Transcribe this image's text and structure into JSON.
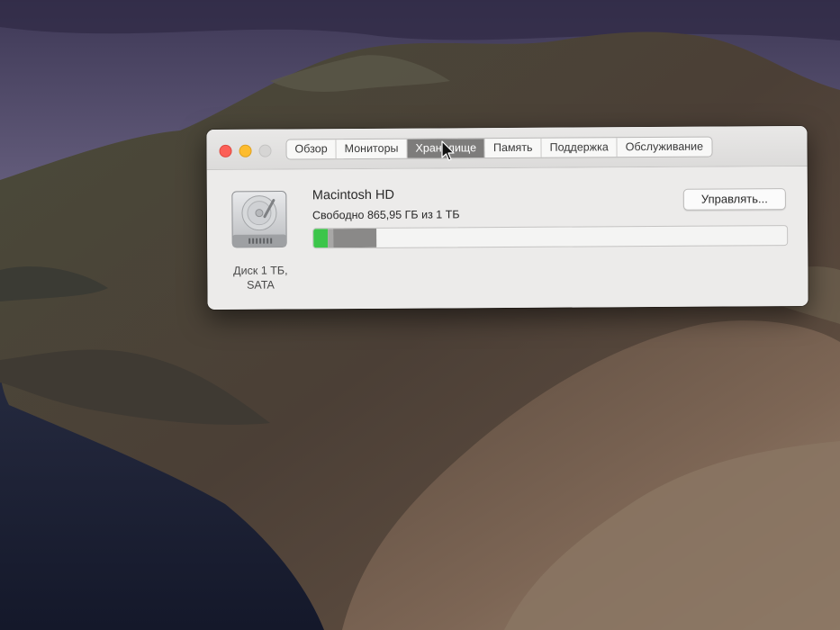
{
  "window": {
    "tabs": [
      {
        "label": "Обзор",
        "active": false
      },
      {
        "label": "Мониторы",
        "active": false
      },
      {
        "label": "Хранилище",
        "active": true
      },
      {
        "label": "Память",
        "active": false
      },
      {
        "label": "Поддержка",
        "active": false
      },
      {
        "label": "Обслуживание",
        "active": false
      }
    ]
  },
  "disk": {
    "icon": "hard-drive-icon",
    "caption_line1": "Диск 1 ТБ,",
    "caption_line2": "SATA"
  },
  "volume": {
    "name": "Macintosh HD",
    "free_text": "Свободно 865,95 ГБ из 1 ТБ",
    "manage_label": "Управлять...",
    "usage_fractions": {
      "apps": 0.03,
      "other": 0.012,
      "system": 0.092,
      "free": 0.866
    },
    "colors": {
      "apps": "#3cc54a",
      "other": "#a8a7a6",
      "system": "#8a8988",
      "free": "#f4f4f3"
    }
  }
}
